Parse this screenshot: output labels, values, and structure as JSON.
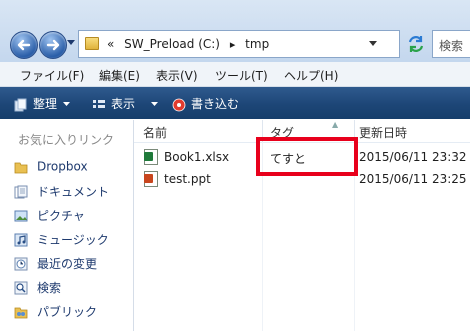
{
  "address": {
    "chevrons": "«",
    "path": [
      "SW_Preload (C:)",
      "tmp"
    ],
    "separator": "▸",
    "search_placeholder": "検索"
  },
  "menu": [
    "ファイル(F)",
    "編集(E)",
    "表示(V)",
    "ツール(T)",
    "ヘルプ(H)"
  ],
  "commands": {
    "organize": "整理",
    "view": "表示",
    "burn": "書き込む"
  },
  "nav": {
    "header": "お気に入りリンク",
    "items": [
      {
        "label": "Dropbox",
        "icon": "folder-icon"
      },
      {
        "label": "ドキュメント",
        "icon": "documents-icon"
      },
      {
        "label": "ピクチャ",
        "icon": "pictures-icon"
      },
      {
        "label": "ミュージック",
        "icon": "music-icon"
      },
      {
        "label": "最近の変更",
        "icon": "recent-icon"
      },
      {
        "label": "検索",
        "icon": "search-folder-icon"
      },
      {
        "label": "パブリック",
        "icon": "public-icon"
      }
    ]
  },
  "columns": {
    "name": "名前",
    "tag": "タグ",
    "modified": "更新日時"
  },
  "files": [
    {
      "name": "Book1.xlsx",
      "tag": "てすと",
      "modified": "2015/06/11 23:32",
      "icon": "excel-icon"
    },
    {
      "name": "test.ppt",
      "tag": "",
      "modified": "2015/06/11 23:25",
      "icon": "powerpoint-icon"
    }
  ]
}
